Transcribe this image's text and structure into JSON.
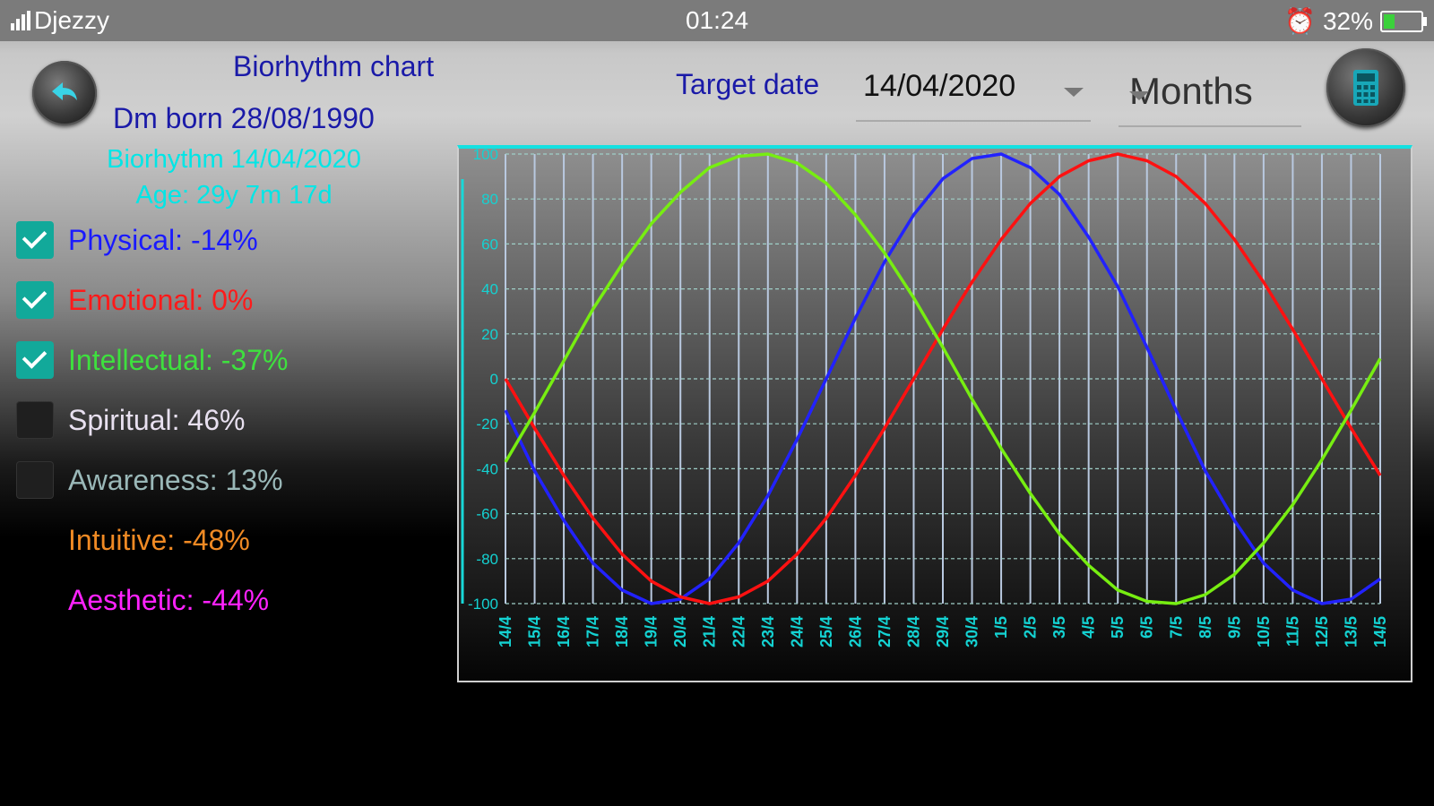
{
  "status_bar": {
    "carrier": "Djezzy",
    "time": "01:24",
    "battery": "32%",
    "battery_level": 0.32
  },
  "header": {
    "title": "Biorhythm chart",
    "born": "Dm born 28/08/1990",
    "target_label": "Target date",
    "target_date": "14/04/2020",
    "range_select": "Months"
  },
  "summary": {
    "biorhythm_date": "Biorhythm 14/04/2020",
    "age": "Age: 29y  7m  17d"
  },
  "legend": [
    {
      "label": "Physical: -14%",
      "checked": true,
      "color": "#1a1aff"
    },
    {
      "label": "Emotional: 0%",
      "checked": true,
      "color": "#ff1a1a"
    },
    {
      "label": "Intellectual: -37%",
      "checked": true,
      "color": "#3ee03e"
    },
    {
      "label": "Spiritual: 46%",
      "checked": false,
      "color": "#e8e0f0"
    },
    {
      "label": "Awareness: 13%",
      "checked": false,
      "color": "#9ab8b8"
    },
    {
      "label": "Intuitive: -48%",
      "checked": null,
      "color": "#f08a24"
    },
    {
      "label": "Aesthetic: -44%",
      "checked": null,
      "color": "#ff22ff"
    }
  ],
  "icons": {
    "back": "back-arrow-icon",
    "calculator": "calculator-icon"
  },
  "chart_data": {
    "type": "line",
    "x": [
      "14/4",
      "15/4",
      "16/4",
      "17/4",
      "18/4",
      "19/4",
      "20/4",
      "21/4",
      "22/4",
      "23/4",
      "24/4",
      "25/4",
      "26/4",
      "27/4",
      "28/4",
      "29/4",
      "30/4",
      "1/5",
      "2/5",
      "3/5",
      "4/5",
      "5/5",
      "6/5",
      "7/5",
      "8/5",
      "9/5",
      "10/5",
      "11/5",
      "12/5",
      "13/5",
      "14/5"
    ],
    "ylim": [
      -100,
      100
    ],
    "yticks": [
      "100",
      "80",
      "60",
      "40",
      "20",
      "0",
      "-20",
      "-40",
      "-60",
      "-80",
      "-100"
    ],
    "grid": true,
    "series": [
      {
        "color": "#2222ff",
        "values": [
          -14,
          -41,
          -63,
          -82,
          -94,
          -100,
          -98,
          -89,
          -73,
          -52,
          -27,
          0,
          27,
          52,
          73,
          89,
          98,
          100,
          94,
          82,
          63,
          41,
          14,
          -14,
          -41,
          -63,
          -82,
          -94,
          -100,
          -98,
          -89
        ]
      },
      {
        "color": "#ff1111",
        "values": [
          0,
          -22,
          -43,
          -62,
          -78,
          -90,
          -97,
          -100,
          -97,
          -90,
          -78,
          -62,
          -43,
          -22,
          0,
          22,
          43,
          62,
          78,
          90,
          97,
          100,
          97,
          90,
          78,
          62,
          43,
          22,
          0,
          -22,
          -43
        ]
      },
      {
        "color": "#77ee11",
        "values": [
          -37,
          -15,
          8,
          31,
          51,
          69,
          83,
          94,
          99,
          100,
          96,
          87,
          73,
          56,
          36,
          14,
          -9,
          -31,
          -51,
          -69,
          -83,
          -94,
          -99,
          -100,
          -96,
          -87,
          -73,
          -56,
          -36,
          -14,
          9
        ]
      }
    ]
  }
}
